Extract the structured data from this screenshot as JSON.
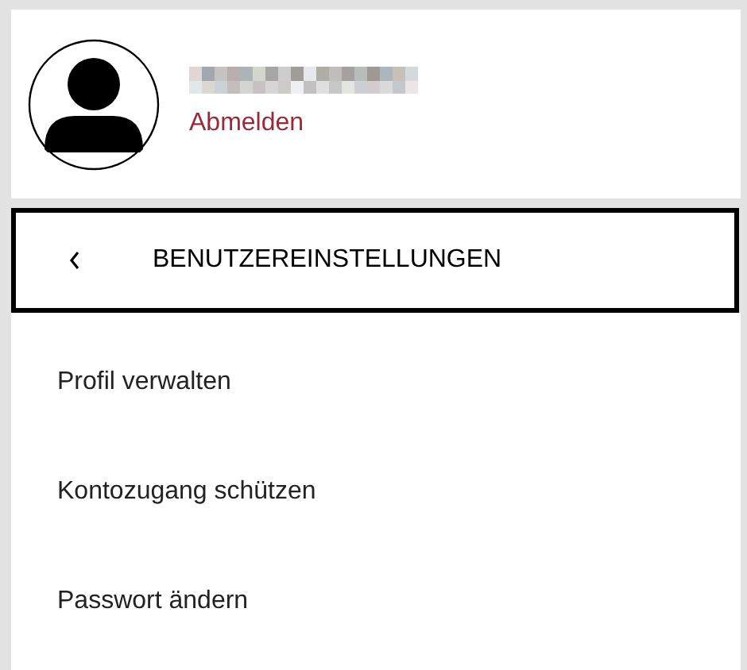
{
  "account": {
    "logout_link": "Abmelden"
  },
  "section_header": {
    "title": "BENUTZEREINSTELLUNGEN"
  },
  "menu_items": [
    {
      "label": "Profil verwalten"
    },
    {
      "label": "Kontozugang schützen"
    },
    {
      "label": "Passwort ändern"
    }
  ]
}
